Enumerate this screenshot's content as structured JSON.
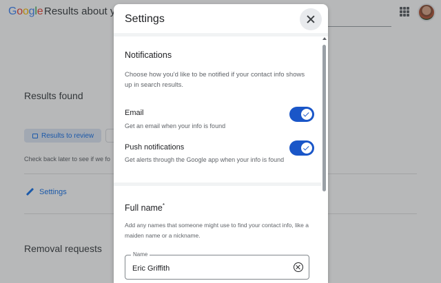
{
  "background": {
    "logo": "Google",
    "logo_colors": [
      "#4285f4",
      "#ea4335",
      "#fbbc05",
      "#4285f4",
      "#34a853",
      "#ea4335"
    ],
    "page_title": "Results about yo",
    "results_title": "Results found",
    "results_chip": "Results to review",
    "check_back": "Check back later to see if we fo",
    "settings_link": "Settings",
    "removal_title": "Removal requests"
  },
  "dialog": {
    "title": "Settings",
    "notifications": {
      "title": "Notifications",
      "description": "Choose how you'd like to be notified if your contact info shows up in search results.",
      "email": {
        "label": "Email",
        "description": "Get an email when your info is found",
        "enabled": true
      },
      "push": {
        "label": "Push notifications",
        "description": "Get alerts through the Google app when your info is found",
        "enabled": true
      }
    },
    "full_name": {
      "title": "Full name",
      "required_marker": "*",
      "description": "Add any names that someone might use to find your contact info, like a maiden name or a nickname.",
      "field_label": "Name",
      "field_value": "Eric Griffith"
    }
  },
  "colors": {
    "accent": "#1a73e8",
    "toggle_on": "#1a56c8"
  }
}
